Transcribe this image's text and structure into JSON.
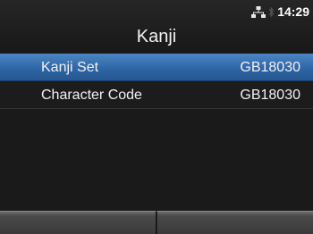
{
  "status": {
    "time": "14:29",
    "icons": [
      "network-icon",
      "bluetooth-icon"
    ]
  },
  "header": {
    "title": "Kanji"
  },
  "settings": [
    {
      "label": "Kanji Set",
      "value": "GB18030",
      "selected": true
    },
    {
      "label": "Character Code",
      "value": "GB18030",
      "selected": false
    }
  ],
  "softkeys": {
    "left_label": "",
    "right_label": ""
  },
  "colors": {
    "selection": "#2f66a6",
    "background": "#1c1c1c",
    "text": "#f2f2f2"
  }
}
